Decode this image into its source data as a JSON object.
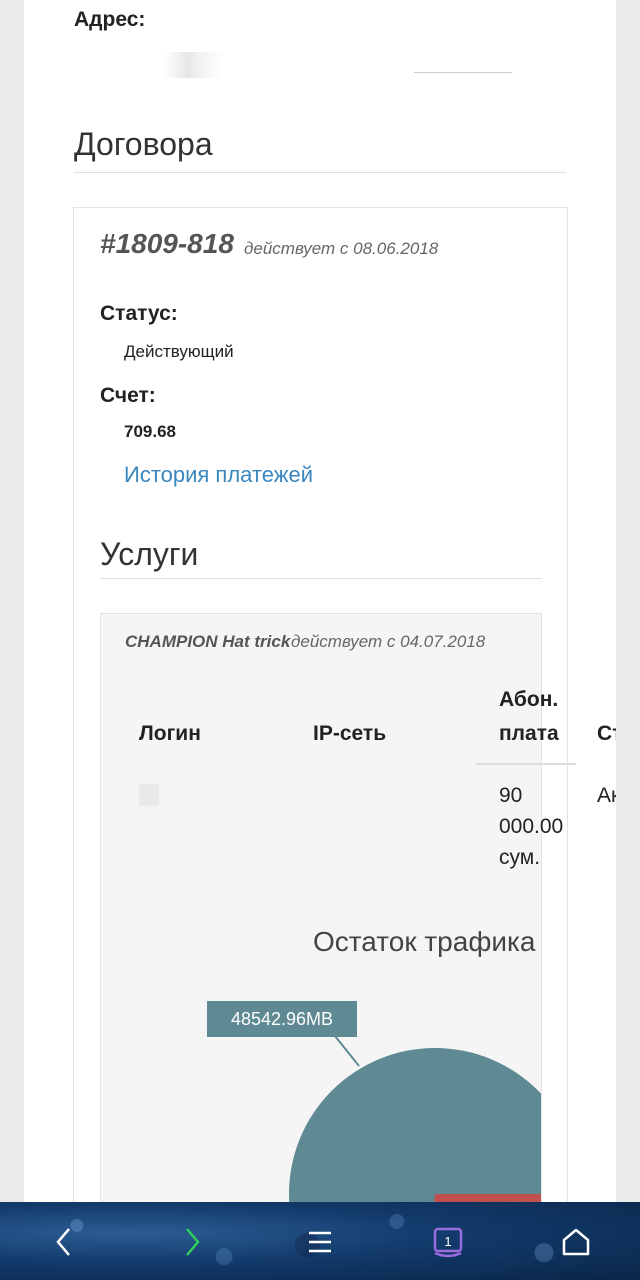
{
  "address": {
    "label": "Адрес:"
  },
  "contracts": {
    "title": "Договора",
    "contract": {
      "number": "#1809-818",
      "since": "действует с 08.06.2018",
      "status_label": "Статус:",
      "status_value": "Действующий",
      "account_label": "Счет:",
      "account_value": "709.68",
      "history_link": "История платежей"
    }
  },
  "services": {
    "title": "Услуги",
    "service": {
      "name": "CHAMPION Hat trick",
      "since": "действует с 04.07.2018",
      "table": {
        "headers": [
          "Логин",
          "IP-сеть",
          "Абон.",
          "плата",
          "Стат"
        ],
        "row": {
          "fee_line1": "90",
          "fee_line2": "000.00",
          "fee_line3": "сум.",
          "status": "Акти"
        }
      },
      "chart_title": "Остаток трафика",
      "chart_data": {
        "type": "pie",
        "title": "Остаток трафика",
        "slices": [
          {
            "label": "48542.96MB",
            "color": "#5f8a93"
          },
          {
            "label": "",
            "color": "#c05050"
          }
        ]
      }
    }
  },
  "nav": {
    "back_icon": "back-chevron-icon",
    "forward_icon": "forward-chevron-icon",
    "menu_icon": "menu-icon",
    "tabs_count": "1",
    "home_icon": "home-icon",
    "colors": {
      "forward": "#2fcf5a",
      "tabs": "#9b6be0",
      "default": "#ffffff"
    }
  }
}
